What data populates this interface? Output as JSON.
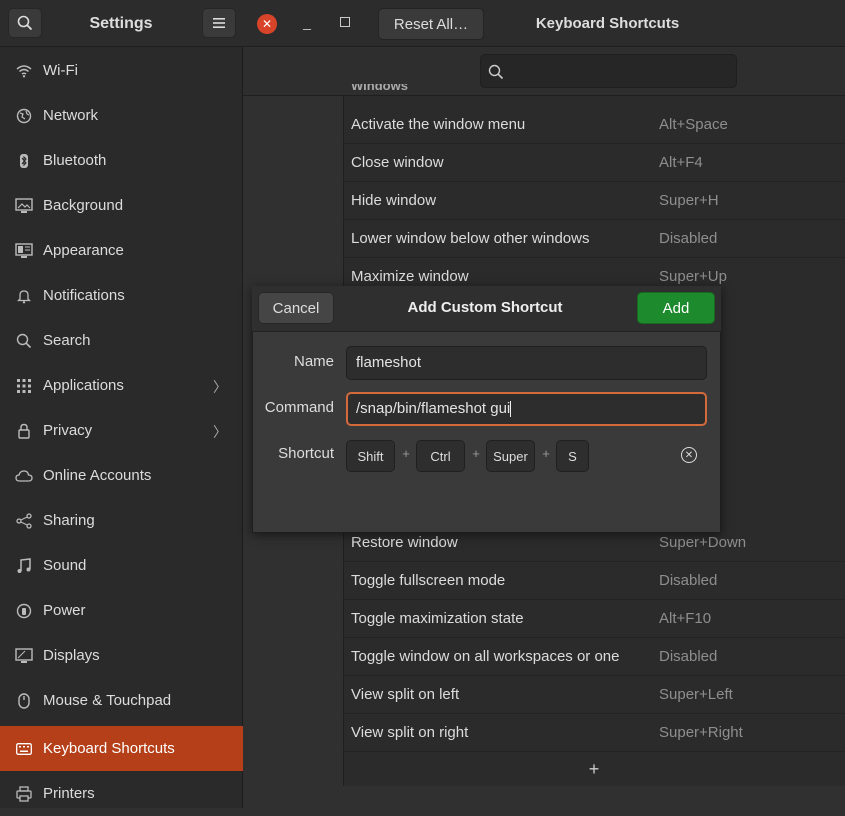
{
  "sidebar": {
    "title": "Settings",
    "items": [
      {
        "label": "Wi-Fi",
        "icon": "wifi-icon"
      },
      {
        "label": "Network",
        "icon": "network-icon"
      },
      {
        "label": "Bluetooth",
        "icon": "bluetooth-icon"
      },
      {
        "label": "Background",
        "icon": "background-icon"
      },
      {
        "label": "Appearance",
        "icon": "appearance-icon"
      },
      {
        "label": "Notifications",
        "icon": "bell-icon"
      },
      {
        "label": "Search",
        "icon": "search-icon"
      },
      {
        "label": "Applications",
        "icon": "grid-icon"
      },
      {
        "label": "Privacy",
        "icon": "lock-icon"
      },
      {
        "label": "Online Accounts",
        "icon": "cloud-icon"
      },
      {
        "label": "Sharing",
        "icon": "share-icon"
      },
      {
        "label": "Sound",
        "icon": "music-icon"
      },
      {
        "label": "Power",
        "icon": "power-icon"
      },
      {
        "label": "Displays",
        "icon": "display-icon"
      },
      {
        "label": "Mouse & Touchpad",
        "icon": "mouse-icon"
      },
      {
        "label": "Keyboard Shortcuts",
        "icon": "keyboard-icon"
      },
      {
        "label": "Printers",
        "icon": "printer-icon"
      }
    ]
  },
  "header": {
    "reset_label": "Reset All…",
    "title": "Keyboard Shortcuts"
  },
  "shortcuts": [
    {
      "label": "Activate the window menu",
      "key": "Alt+Space"
    },
    {
      "label": "Close window",
      "key": "Alt+F4"
    },
    {
      "label": "Hide window",
      "key": "Super+H"
    },
    {
      "label": "Lower window below other windows",
      "key": "Disabled"
    },
    {
      "label": "Maximize window",
      "key": "Super+Up"
    },
    {
      "label": "Restore window",
      "key": "Super+Down"
    },
    {
      "label": "Toggle fullscreen mode",
      "key": "Disabled"
    },
    {
      "label": "Toggle maximization state",
      "key": "Alt+F10"
    },
    {
      "label": "Toggle window on all workspaces or one",
      "key": "Disabled"
    },
    {
      "label": "View split on left",
      "key": "Super+Left"
    },
    {
      "label": "View split on right",
      "key": "Super+Right"
    }
  ],
  "section_title_partial": "Windows",
  "add_row_symbol": "+",
  "dialog": {
    "cancel_label": "Cancel",
    "title": "Add Custom Shortcut",
    "add_label": "Add",
    "name_label": "Name",
    "name_value": "flameshot",
    "command_label": "Command",
    "command_value": "/snap/bin/flameshot gui",
    "shortcut_label": "Shortcut",
    "keys": [
      "Shift",
      "Ctrl",
      "Super",
      "S"
    ]
  },
  "colors": {
    "active_sidebar": "#b43f18",
    "add_button": "#1e8a2e",
    "close_button": "#d8442a",
    "focus_border": "#d26a3c"
  }
}
